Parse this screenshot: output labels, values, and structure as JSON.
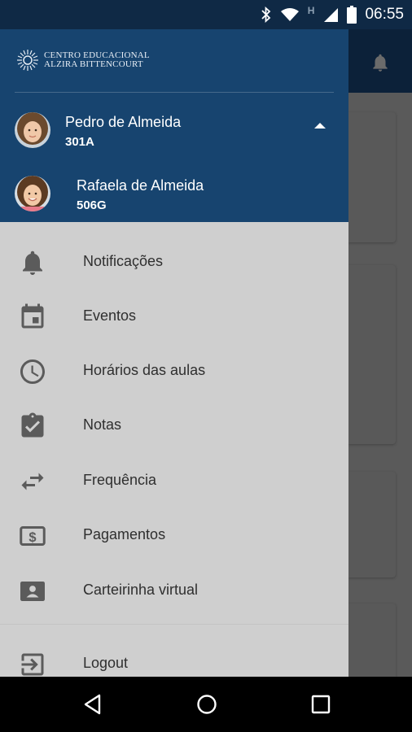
{
  "status_bar": {
    "time": "06:55",
    "network_letter": "H"
  },
  "logo": {
    "line1": "CENTRO EDUCACIONAL",
    "line2": "ALZIRA BITTENCOURT"
  },
  "accounts": [
    {
      "name": "Pedro de Almeida",
      "class": "301A"
    },
    {
      "name": "Rafaela de Almeida",
      "class": "506G"
    }
  ],
  "menu": {
    "items": [
      {
        "label": "Notificações",
        "icon": "bell-icon"
      },
      {
        "label": "Eventos",
        "icon": "calendar-icon"
      },
      {
        "label": "Horários das aulas",
        "icon": "clock-icon"
      },
      {
        "label": "Notas",
        "icon": "clipboard-check-icon"
      },
      {
        "label": "Frequência",
        "icon": "swap-arrows-icon"
      },
      {
        "label": "Pagamentos",
        "icon": "dollar-icon"
      },
      {
        "label": "Carteirinha virtual",
        "icon": "id-card-icon"
      }
    ],
    "logout": {
      "label": "Logout",
      "icon": "logout-icon"
    }
  },
  "colors": {
    "header": "#17446f",
    "status_bar": "#0f2945",
    "drawer": "#cfcfcf",
    "icon": "#5b5b5b"
  }
}
